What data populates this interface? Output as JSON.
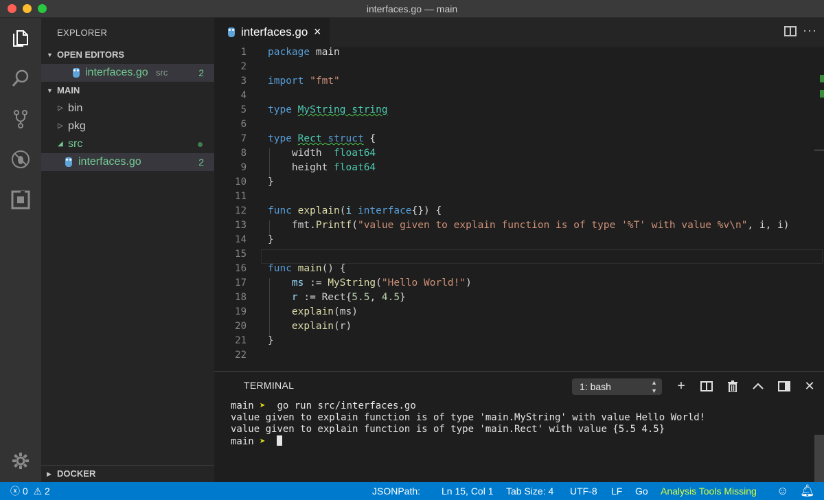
{
  "window": {
    "title": "interfaces.go — main"
  },
  "sidebar": {
    "title": "EXPLORER",
    "open_editors": {
      "label": "OPEN EDITORS",
      "items": [
        {
          "name": "interfaces.go",
          "folder": "src",
          "problems": "2"
        }
      ]
    },
    "main": {
      "label": "MAIN",
      "items": [
        {
          "name": "bin"
        },
        {
          "name": "pkg"
        },
        {
          "name": "src"
        },
        {
          "name": "interfaces.go",
          "problems": "2"
        }
      ]
    },
    "docker": {
      "label": "DOCKER"
    }
  },
  "editor": {
    "tab": {
      "label": "interfaces.go",
      "close": "×"
    },
    "line_numbers": [
      "1",
      "2",
      "3",
      "4",
      "5",
      "6",
      "7",
      "8",
      "9",
      "10",
      "11",
      "12",
      "13",
      "14",
      "15",
      "16",
      "17",
      "18",
      "19",
      "20",
      "21",
      "22"
    ],
    "code": {
      "l1_kw": "package",
      "l1_name": " main",
      "l3_kw": "import",
      "l3_str": "\"fmt\"",
      "l5_kw": "type",
      "l5_name": "MyString",
      "l5_type": "string",
      "l7_kw": "type",
      "l7_name": "Rect",
      "l7_struct": "struct",
      "l7_brace": " {",
      "l8_field": "width",
      "l8_type": "float64",
      "l9_field": "height",
      "l9_type": "float64",
      "l10": "}",
      "l12_kw": "func",
      "l12_fn": "explain",
      "l12_open": "(",
      "l12_param": "i",
      "l12_iface": "interface",
      "l12_rest": "{}) {",
      "l13_pkg": "fmt.",
      "l13_fn": "Printf",
      "l13_open": "(",
      "l13_str": "\"value given to explain function is of type '%T' with value %v\\n\"",
      "l13_rest": ", i, i)",
      "l14": "}",
      "l16_kw": "func",
      "l16_fn": "main",
      "l16_rest": "() {",
      "l17_var": "ms",
      "l17_op": " := ",
      "l17_fn": "MyString",
      "l17_open": "(",
      "l17_str": "\"Hello World!\"",
      "l17_close": ")",
      "l18_var": "r",
      "l18_op": " := Rect{",
      "l18_n1": "5.5",
      "l18_sep": ", ",
      "l18_n2": "4.5",
      "l18_close": "}",
      "l19_fn": "explain",
      "l19_rest": "(ms)",
      "l20_fn": "explain",
      "l20_rest": "(r)",
      "l21": "}"
    }
  },
  "panel": {
    "title": "TERMINAL",
    "shell": "1: bash",
    "lines": [
      {
        "prompt": "main",
        "arrow": "➤",
        "cmd": "go run src/interfaces.go"
      },
      {
        "text": "value given to explain function is of type 'main.MyString' with value Hello World!"
      },
      {
        "text": "value given to explain function is of type 'main.Rect' with value {5.5 4.5}"
      },
      {
        "prompt": "main",
        "arrow": "➤"
      }
    ]
  },
  "statusbar": {
    "errors": "0",
    "warnings": "2",
    "jsonpath": "JSONPath:",
    "position": "Ln 15, Col 1",
    "tab_size": "Tab Size: 4",
    "encoding": "UTF-8",
    "eol": "LF",
    "language": "Go",
    "analysis": "Analysis Tools Missing"
  },
  "colors": {
    "statusbar": "#007acc",
    "accent_green": "#73c991"
  }
}
